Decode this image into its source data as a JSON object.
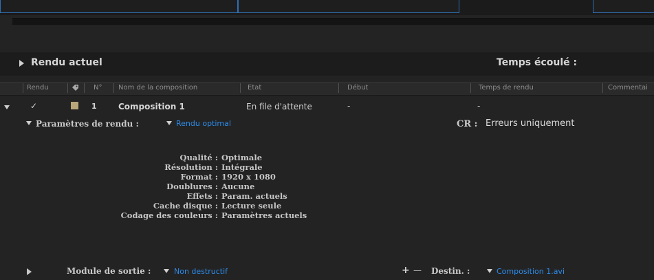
{
  "current": {
    "label": "Rendu actuel",
    "elapsed_label": "Temps écoulé :"
  },
  "columns": [
    "Rendu",
    "N°",
    "Nom de la composition",
    "Etat",
    "Début",
    "Temps de rendu",
    "Commentai"
  ],
  "item": {
    "check": "✓",
    "number": "1",
    "name": "Composition 1",
    "status": "En file d'attente",
    "start": "-",
    "render_time": "-",
    "label_color": "#b9a57a"
  },
  "render_settings": {
    "label": "Paramètres de rendu :",
    "value": "Rendu optimal",
    "log_label": "CR :",
    "log_value": "Erreurs uniquement"
  },
  "details": [
    {
      "label": "Qualité :",
      "value": "Optimale"
    },
    {
      "label": "Résolution :",
      "value": "Intégrale"
    },
    {
      "label": "Format :",
      "value": "1920 x 1080"
    },
    {
      "label": "Doublures :",
      "value": "Aucune"
    },
    {
      "label": "Effets :",
      "value": "Param. actuels"
    },
    {
      "label": "Cache disque :",
      "value": "Lecture seule"
    },
    {
      "label": "Codage des couleurs :",
      "value": "Paramètres actuels"
    }
  ],
  "output": {
    "label": "Module de sortie :",
    "value": "Non destructif",
    "plus": "+",
    "minus": "—",
    "dest_label": "Destin. :",
    "dest_value": "Composition 1.avi"
  },
  "colors": {
    "accent": "#2d8ceb",
    "frame_blue": "#2f6fb3",
    "background": "#232323"
  }
}
